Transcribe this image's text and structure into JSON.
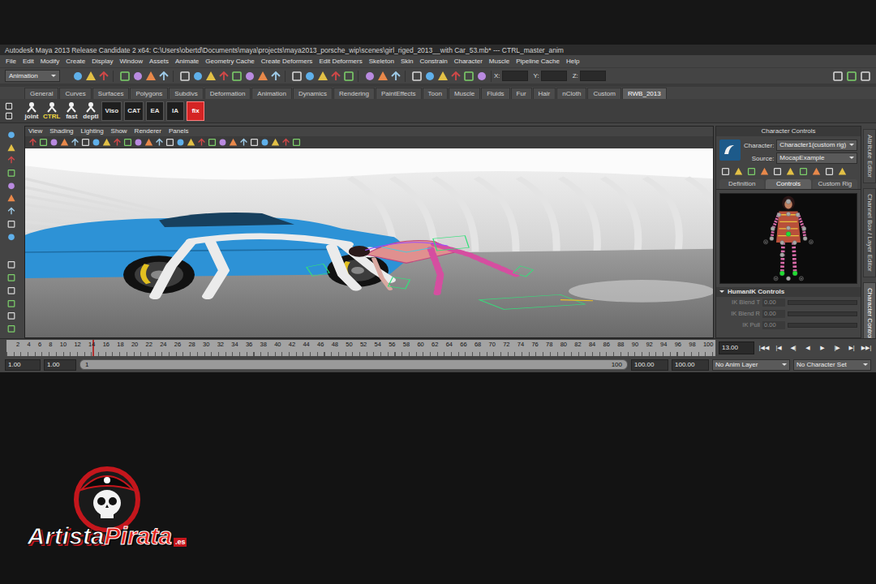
{
  "window": {
    "title": "Autodesk Maya 2013 Release Candidate 2 x64: C:\\Users\\obertd\\Documents\\maya\\projects\\maya2013_porsche_wip\\scenes\\girl_riged_2013__with Car_53.mb*  ---  CTRL_master_anim"
  },
  "menu": [
    "File",
    "Edit",
    "Modify",
    "Create",
    "Display",
    "Window",
    "Assets",
    "Animate",
    "Geometry Cache",
    "Create Deformers",
    "Edit Deformers",
    "Skeleton",
    "Skin",
    "Constrain",
    "Character",
    "Muscle",
    "Pipeline Cache",
    "Help"
  ],
  "status_line": {
    "mode": "Animation",
    "fields": [
      "X:",
      "Y:",
      "Z:"
    ]
  },
  "shelf": {
    "tabs": [
      {
        "label": "General",
        "selected": false
      },
      {
        "label": "Curves",
        "selected": false
      },
      {
        "label": "Surfaces",
        "selected": false
      },
      {
        "label": "Polygons",
        "selected": false
      },
      {
        "label": "Subdivs",
        "selected": false
      },
      {
        "label": "Deformation",
        "selected": false
      },
      {
        "label": "Animation",
        "selected": false
      },
      {
        "label": "Dynamics",
        "selected": false
      },
      {
        "label": "Rendering",
        "selected": false
      },
      {
        "label": "PaintEffects",
        "selected": false
      },
      {
        "label": "Toon",
        "selected": false
      },
      {
        "label": "Muscle",
        "selected": false
      },
      {
        "label": "Fluids",
        "selected": false
      },
      {
        "label": "Fur",
        "selected": false
      },
      {
        "label": "Hair",
        "selected": false
      },
      {
        "label": "nCloth",
        "selected": false
      },
      {
        "label": "Custom",
        "selected": false
      },
      {
        "label": "RWB_2013",
        "selected": true
      }
    ],
    "buttons": [
      {
        "label": "joint",
        "kind": "icon",
        "color": "#e6e6e6"
      },
      {
        "label": "CTRL",
        "kind": "icon",
        "color": "#f0d840"
      },
      {
        "label": "fast",
        "kind": "icon",
        "color": "#e6e6e6"
      },
      {
        "label": "deptl",
        "kind": "icon",
        "color": "#e6e6e6"
      },
      {
        "label": "Viso",
        "kind": "box",
        "color": "#e6e6e6"
      },
      {
        "label": "CAT",
        "kind": "box",
        "color": "#e6e6e6"
      },
      {
        "label": "EA",
        "kind": "box",
        "color": "#e6e6e6"
      },
      {
        "label": "IA",
        "kind": "box",
        "color": "#e6e6e6"
      },
      {
        "label": "fix",
        "kind": "alert",
        "color": "#d42424"
      }
    ]
  },
  "viewport": {
    "menu": [
      "View",
      "Shading",
      "Lighting",
      "Show",
      "Renderer",
      "Panels"
    ]
  },
  "character_controls": {
    "title": "Character Controls",
    "character_label": "Character:",
    "character": "Character1(custom rig)",
    "source_label": "Source:",
    "source": "MocapExample",
    "tabs": [
      {
        "label": "Definition",
        "selected": false
      },
      {
        "label": "Controls",
        "selected": true
      },
      {
        "label": "Custom Rig",
        "selected": false
      }
    ],
    "effectors": [
      {
        "selected": false
      },
      {
        "selected": false
      },
      {
        "selected": false
      },
      {
        "selected": false
      },
      {
        "selected": false
      },
      {
        "selected": true
      },
      {
        "selected": false
      },
      {
        "selected": false
      },
      {
        "selected": false
      },
      {
        "selected": false
      },
      {
        "selected": false
      },
      {
        "selected": false
      },
      {
        "selected": false
      },
      {
        "selected": true
      },
      {
        "selected": true
      },
      {
        "selected": false
      }
    ],
    "section": "HumanIK Controls",
    "sliders": [
      {
        "label": "IK Blend T",
        "value": "0.00",
        "level": 0,
        "disabled": true
      },
      {
        "label": "IK Blend R",
        "value": "0.00",
        "level": 0,
        "disabled": true
      },
      {
        "label": "IK Pull",
        "value": "0.00",
        "level": 0,
        "disabled": true
      }
    ]
  },
  "side_tabs": [
    {
      "label": "Attribute Editor",
      "selected": false
    },
    {
      "label": "Channel Box / Layer Editor",
      "selected": false
    },
    {
      "label": "Character Controls",
      "selected": true
    }
  ],
  "timeline": {
    "ticks": [
      "2",
      "4",
      "6",
      "8",
      "10",
      "12",
      "14",
      "16",
      "18",
      "20",
      "22",
      "24",
      "26",
      "28",
      "30",
      "32",
      "34",
      "36",
      "38",
      "40",
      "42",
      "44",
      "46",
      "48",
      "50",
      "52",
      "54",
      "56",
      "58",
      "60",
      "62",
      "64",
      "66",
      "68",
      "70",
      "72",
      "74",
      "76",
      "78",
      "80",
      "82",
      "84",
      "86",
      "88",
      "90",
      "92",
      "94",
      "96",
      "98",
      "100"
    ],
    "current_frame": "13.00",
    "playhead": 0.121,
    "playback": [
      "|◀◀",
      "|◀",
      "◀|",
      "◀",
      "▶",
      "|▶",
      "▶|",
      "▶▶|"
    ]
  },
  "range": {
    "start": "1.00",
    "inner_start": "1.00",
    "bar_start": "1",
    "bar_end": "100",
    "inner_end": "100.00",
    "end": "100.00",
    "anim_layer": "No Anim Layer",
    "character_set": "No Character Set"
  },
  "watermark": {
    "word1": "Artista",
    "word2": "Pirata",
    "suffix": ".es"
  }
}
